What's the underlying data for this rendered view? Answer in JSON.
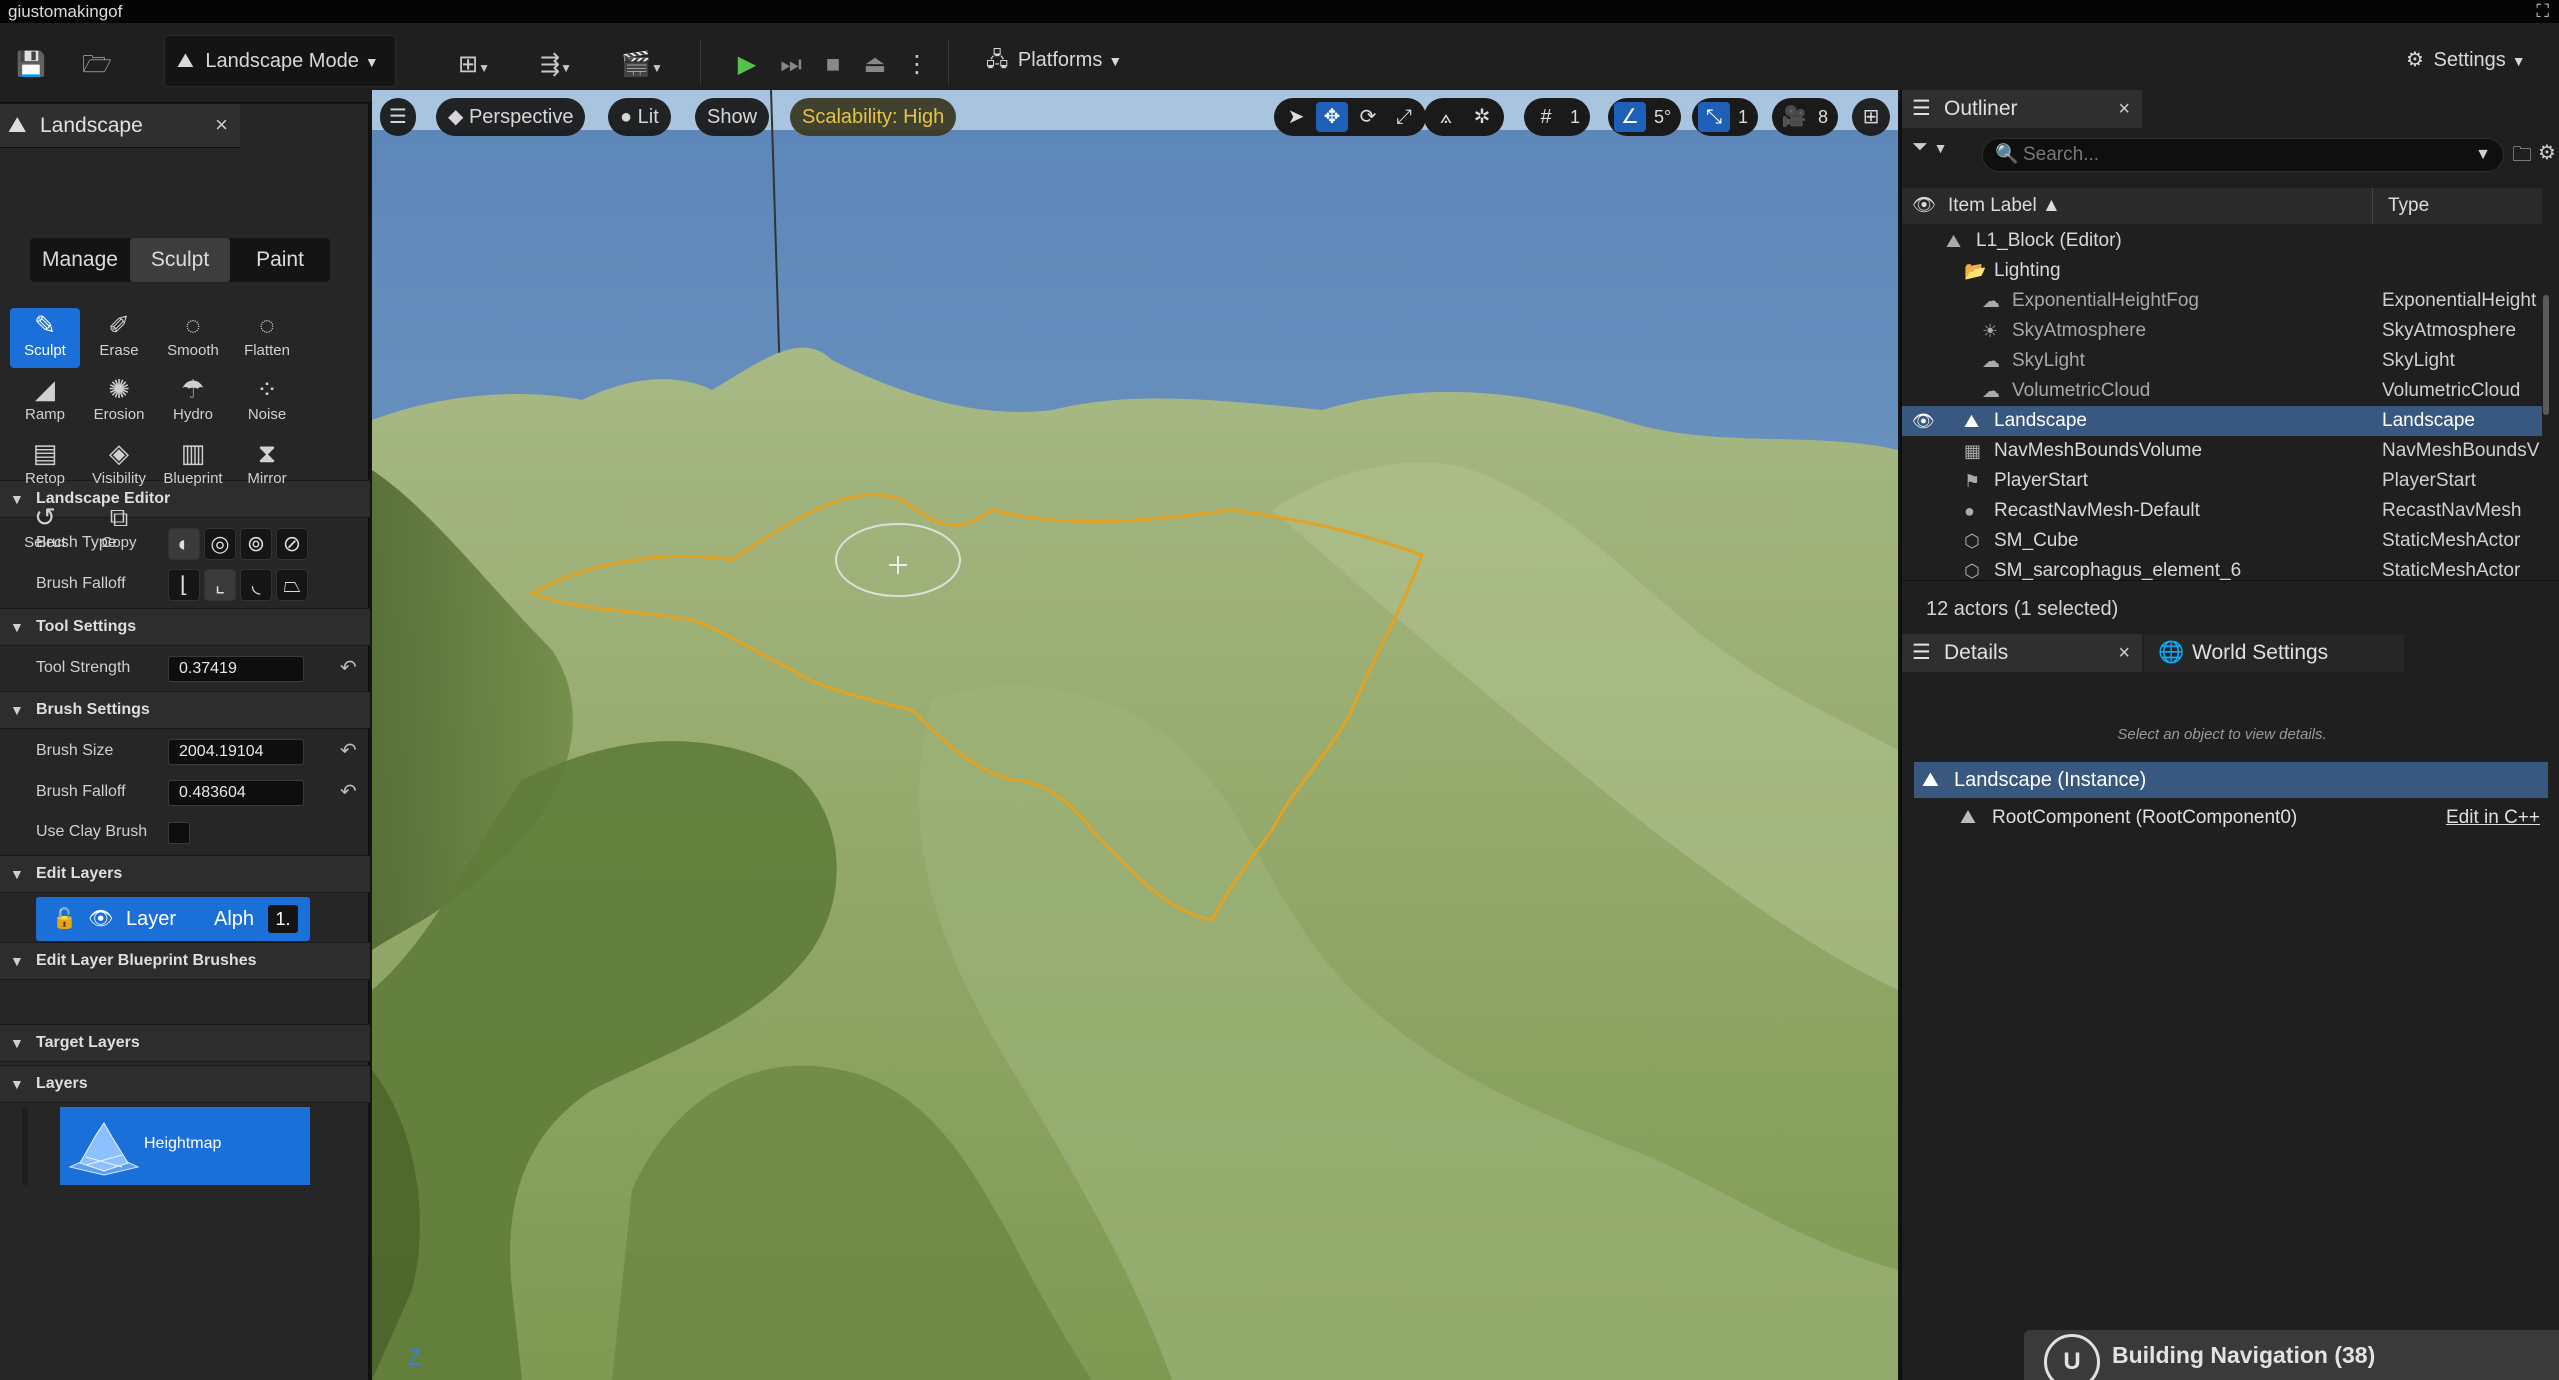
{
  "window": {
    "title": "giustomakingof",
    "maximize_glyph": "⛶"
  },
  "toolbar": {
    "mode_label": "Landscape Mode",
    "platforms_label": "Platforms",
    "settings_label": "Settings"
  },
  "landscape_panel": {
    "tab_label": "Landscape",
    "modes": [
      "Manage",
      "Sculpt",
      "Paint"
    ],
    "active_mode": "Sculpt",
    "tools": [
      {
        "label": "Sculpt",
        "icon": "✎"
      },
      {
        "label": "Erase",
        "icon": "✐"
      },
      {
        "label": "Smooth",
        "icon": "◌"
      },
      {
        "label": "Flatten",
        "icon": "◌"
      },
      {
        "label": "Ramp",
        "icon": "◢"
      },
      {
        "label": "Erosion",
        "icon": "✺"
      },
      {
        "label": "Hydro",
        "icon": "☂"
      },
      {
        "label": "Noise",
        "icon": "⁘"
      },
      {
        "label": "Retop",
        "icon": "▤"
      },
      {
        "label": "Visibility",
        "icon": "◈"
      },
      {
        "label": "Blueprint",
        "icon": "▥"
      },
      {
        "label": "Mirror",
        "icon": "⧗"
      },
      {
        "label": "Select",
        "icon": "↺"
      },
      {
        "label": "Copy",
        "icon": "⧉"
      }
    ],
    "sections": {
      "landscape_editor": "Landscape Editor",
      "tool_settings": "Tool Settings",
      "brush_settings": "Brush Settings",
      "edit_layers": "Edit Layers",
      "edit_layer_bp": "Edit Layer Blueprint Brushes",
      "target_layers": "Target Layers",
      "layers": "Layers"
    },
    "props": {
      "brush_type": "Brush Type",
      "brush_falloff_shape": "Brush Falloff",
      "tool_strength_label": "Tool Strength",
      "tool_strength": "0.37419",
      "brush_size_label": "Brush Size",
      "brush_size": "2004.19104",
      "brush_falloff_label": "Brush Falloff",
      "brush_falloff": "0.483604",
      "use_clay_label": "Use Clay Brush"
    },
    "edit_layer": {
      "name": "Layer",
      "alpha": "Alph",
      "num": "1."
    },
    "heightmap_label": "Heightmap"
  },
  "viewport": {
    "perspective": "Perspective",
    "lit": "Lit",
    "show": "Show",
    "scalability": "Scalability: High",
    "grid_value": "1",
    "angle_value": "5°",
    "scale_value": "1",
    "camera_speed": "8"
  },
  "outliner": {
    "tab_label": "Outliner",
    "search_placeholder": "Search...",
    "col_label": "Item Label ▲",
    "col_type": "Type",
    "rows": [
      {
        "label": "L1_Block (Editor)",
        "type": "",
        "indent": 1,
        "icon": "⛰"
      },
      {
        "label": "Lighting",
        "type": "",
        "indent": 2,
        "icon": "📂"
      },
      {
        "label": "ExponentialHeightFog",
        "type": "ExponentialHeight",
        "indent": 3,
        "icon": "☁"
      },
      {
        "label": "SkyAtmosphere",
        "type": "SkyAtmosphere",
        "indent": 3,
        "icon": "☀"
      },
      {
        "label": "SkyLight",
        "type": "SkyLight",
        "indent": 3,
        "icon": "☁"
      },
      {
        "label": "VolumetricCloud",
        "type": "VolumetricCloud",
        "indent": 3,
        "icon": "☁"
      },
      {
        "label": "Landscape",
        "type": "Landscape",
        "indent": 2,
        "icon": "⛰",
        "selected": true
      },
      {
        "label": "NavMeshBoundsVolume",
        "type": "NavMeshBoundsV",
        "indent": 2,
        "icon": "▦"
      },
      {
        "label": "PlayerStart",
        "type": "PlayerStart",
        "indent": 2,
        "icon": "⚑"
      },
      {
        "label": "RecastNavMesh-Default",
        "type": "RecastNavMesh",
        "indent": 2,
        "icon": "●"
      },
      {
        "label": "SM_Cube",
        "type": "StaticMeshActor",
        "indent": 2,
        "icon": "⬡"
      },
      {
        "label": "SM_sarcophagus_element_6",
        "type": "StaticMeshActor",
        "indent": 2,
        "icon": "⬡"
      }
    ],
    "count": "12 actors (1 selected)"
  },
  "details": {
    "tab_label": "Details",
    "world_settings_label": "World Settings",
    "hint": "Select an object to view details.",
    "instance": "Landscape (Instance)",
    "root_component": "RootComponent (RootComponent0)",
    "edit_cpp": "Edit in C++"
  },
  "toast": {
    "text": "Building Navigation (38)",
    "logo": "U"
  }
}
